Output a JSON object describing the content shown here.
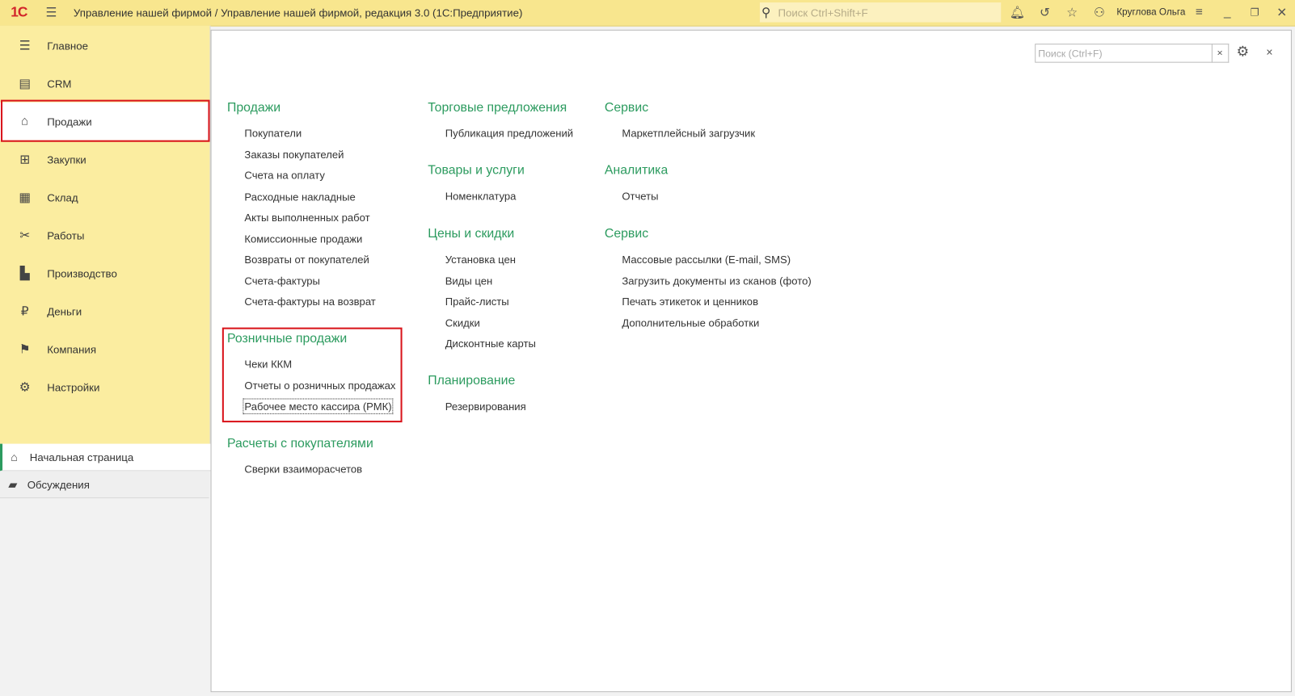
{
  "titlebar": {
    "logo": "1С",
    "title": "Управление нашей фирмой / Управление нашей фирмой, редакция 3.0  (1С:Предприятие)",
    "search_placeholder": "Поиск Ctrl+Shift+F",
    "user": "Круглова Ольга"
  },
  "sidebar": {
    "items": [
      {
        "label": "Главное",
        "icon": "☰",
        "name": "main"
      },
      {
        "label": "CRM",
        "icon": "▤",
        "name": "crm"
      },
      {
        "label": "Продажи",
        "icon": "⌂",
        "name": "sales"
      },
      {
        "label": "Закупки",
        "icon": "⊞",
        "name": "purchases"
      },
      {
        "label": "Склад",
        "icon": "▦",
        "name": "warehouse"
      },
      {
        "label": "Работы",
        "icon": "✂",
        "name": "works"
      },
      {
        "label": "Производство",
        "icon": "▙",
        "name": "production"
      },
      {
        "label": "Деньги",
        "icon": "₽",
        "name": "money"
      },
      {
        "label": "Компания",
        "icon": "⚑",
        "name": "company"
      },
      {
        "label": "Настройки",
        "icon": "⚙",
        "name": "settings"
      }
    ],
    "active": 2,
    "bottom": [
      {
        "label": "Начальная страница",
        "icon": "⌂",
        "name": "home"
      },
      {
        "label": "Обсуждения",
        "icon": "▰",
        "name": "discussions"
      }
    ]
  },
  "content": {
    "search_placeholder": "Поиск (Ctrl+F)",
    "clear": "×",
    "close": "×",
    "groups": [
      {
        "title": "Продажи",
        "items": [
          "Покупатели",
          "Заказы покупателей",
          "Счета на оплату",
          "Расходные накладные",
          "Акты выполненных работ",
          "Комиссионные продажи",
          "Возвраты от покупателей",
          "Счета-фактуры",
          "Счета-фактуры на возврат"
        ]
      },
      {
        "title": "Розничные продажи",
        "items": [
          "Чеки ККМ",
          "Отчеты о розничных продажах",
          "Рабочее место кассира (РМК)"
        ]
      },
      {
        "title": "Расчеты с покупателями",
        "items": [
          "Сверки взаиморасчетов"
        ]
      },
      {
        "title": "Торговые предложения",
        "items": [
          "Публикация предложений"
        ]
      },
      {
        "title": "Товары и услуги",
        "items": [
          "Номенклатура"
        ]
      },
      {
        "title": "Цены и скидки",
        "items": [
          "Установка цен",
          "Виды цен",
          "Прайс-листы",
          "Скидки",
          "Дисконтные карты"
        ]
      },
      {
        "title": "Планирование",
        "items": [
          "Резервирования"
        ]
      },
      {
        "title": "Сервис",
        "items": [
          "Маркетплейсный загрузчик"
        ]
      },
      {
        "title": "Аналитика",
        "items": [
          "Отчеты"
        ]
      },
      {
        "title": "Сервис",
        "items": [
          "Массовые рассылки (E-mail, SMS)",
          "Загрузить документы из сканов (фото)",
          "Печать этикеток и ценников",
          "Дополнительные обработки"
        ]
      }
    ]
  }
}
